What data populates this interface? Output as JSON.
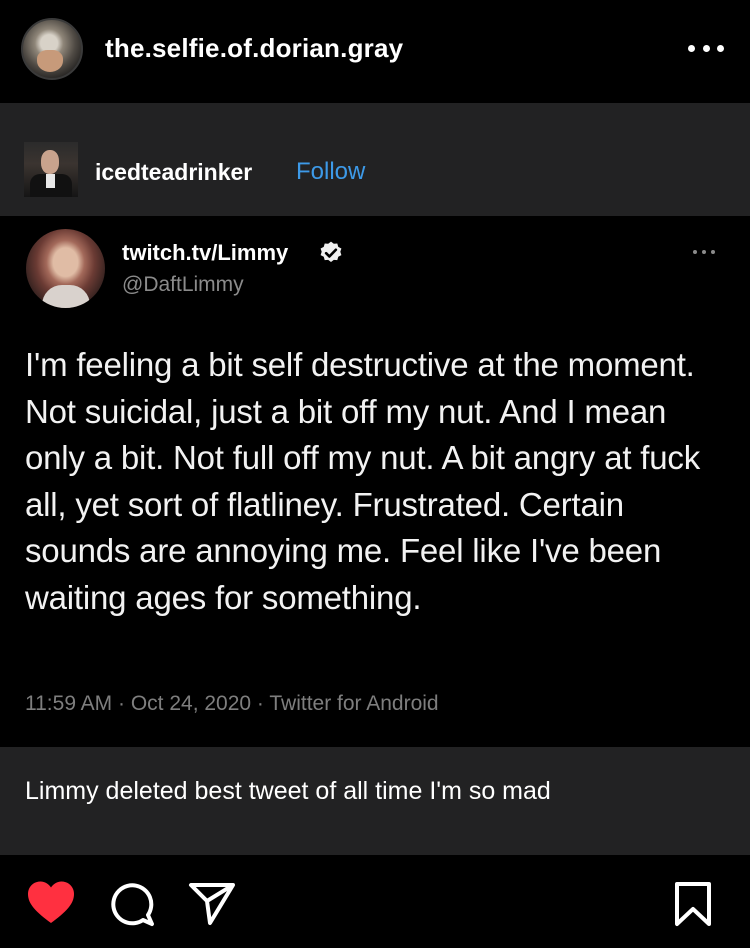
{
  "header": {
    "username": "the.selfie.of.dorian.gray"
  },
  "post": {
    "repost": {
      "username": "icedteadrinker",
      "follow_label": "Follow"
    },
    "tweet": {
      "display_name": "twitch.tv/Limmy",
      "handle": "@DaftLimmy",
      "text": "I'm feeling a bit self destructive at the moment. Not suicidal, just a bit off my nut. And I mean only a bit. Not full off my nut. A bit angry at fuck all, yet sort of flatliney. Frustrated. Certain sounds are annoying me. Feel like I've been waiting ages for something.",
      "meta": "11:59 AM · Oct 24, 2020 · Twitter for Android"
    },
    "caption": "Limmy deleted best tweet of all time I'm so mad"
  },
  "actions": {
    "like_icon": "heart-icon",
    "comment_icon": "comment-icon",
    "share_icon": "send-icon",
    "save_icon": "bookmark-icon",
    "like_color": "#ff3040"
  }
}
